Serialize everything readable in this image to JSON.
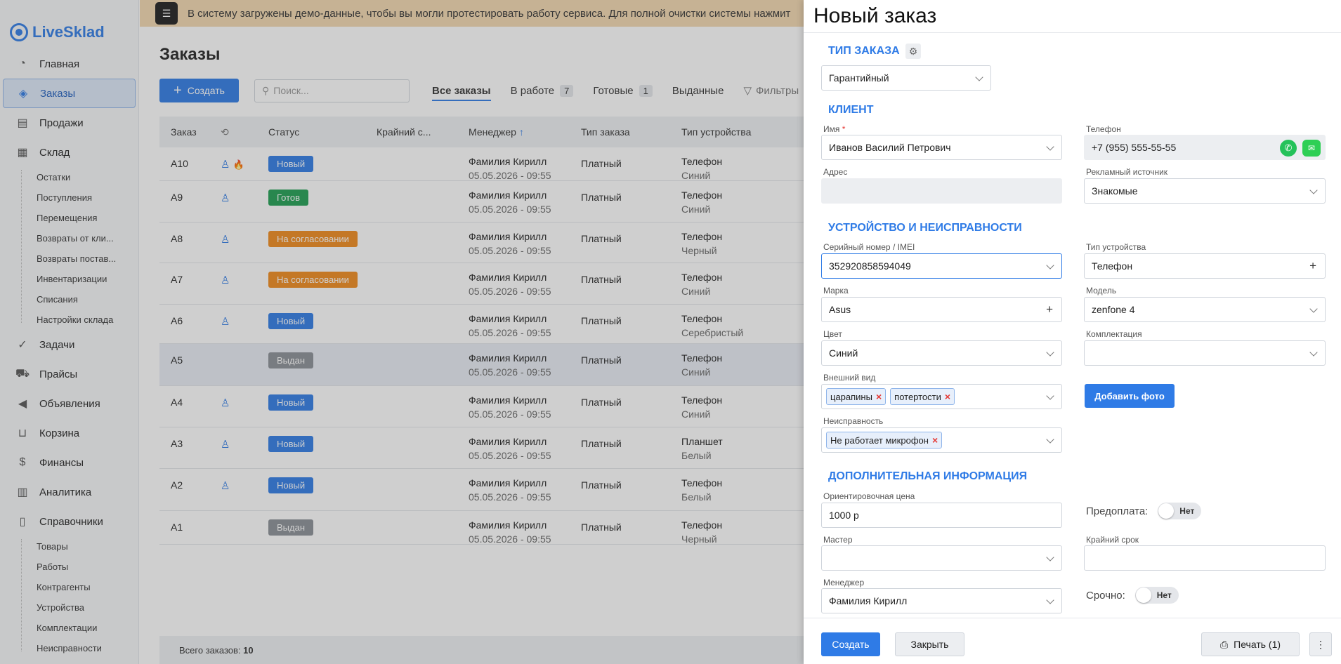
{
  "app": {
    "logo": "LiveSklad"
  },
  "sidebar": {
    "items": [
      {
        "label": "Главная",
        "icon": "gauge-icon"
      },
      {
        "label": "Заказы",
        "icon": "layers-icon",
        "active": true
      },
      {
        "label": "Продажи",
        "icon": "cash-register-icon"
      },
      {
        "label": "Склад",
        "icon": "boxes-icon"
      }
    ],
    "warehouse_sub": [
      "Остатки",
      "Поступления",
      "Перемещения",
      "Возвраты от кли...",
      "Возвраты постав...",
      "Инвентаризации",
      "Списания",
      "Настройки склада"
    ],
    "items2": [
      {
        "label": "Задачи",
        "icon": "check-circle-icon"
      },
      {
        "label": "Прайсы",
        "icon": "truck-icon"
      },
      {
        "label": "Объявления",
        "icon": "megaphone-icon"
      },
      {
        "label": "Корзина",
        "icon": "basket-icon"
      },
      {
        "label": "Финансы",
        "icon": "money-bag-icon"
      },
      {
        "label": "Аналитика",
        "icon": "chart-icon"
      },
      {
        "label": "Справочники",
        "icon": "book-icon"
      }
    ],
    "reference_sub": [
      "Товары",
      "Работы",
      "Контрагенты",
      "Устройства",
      "Комплектации",
      "Неисправности"
    ]
  },
  "banner": {
    "text": "В систему загружены демо-данные, чтобы вы могли протестировать работу сервиса. Для полной очистки системы нажмит"
  },
  "orders": {
    "title": "Заказы",
    "create_label": "Создать",
    "search_placeholder": "Поиск...",
    "tabs": [
      {
        "label": "Все заказы",
        "count": ""
      },
      {
        "label": "В работе",
        "count": "7"
      },
      {
        "label": "Готовые",
        "count": "1"
      },
      {
        "label": "Выданные",
        "count": ""
      }
    ],
    "filter_label": "Фильтры",
    "columns": {
      "order": "Заказ",
      "status": "Статус",
      "deadline": "Крайний с...",
      "manager": "Менеджер",
      "order_type": "Тип заказа",
      "device_type": "Тип устройства"
    },
    "rows": [
      {
        "id": "A10",
        "status": "Новый",
        "status_kind": "new",
        "manager": "Фамилия Кирилл",
        "date": "05.05.2026 - 09:55",
        "type": "Платный",
        "device": "Телефон",
        "color": "Синий",
        "person": true,
        "fire": true
      },
      {
        "id": "A9",
        "status": "Готов",
        "status_kind": "ready",
        "manager": "Фамилия Кирилл",
        "date": "05.05.2026 - 09:55",
        "type": "Платный",
        "device": "Телефон",
        "color": "Синий",
        "person": true
      },
      {
        "id": "A8",
        "status": "На согласовании",
        "status_kind": "agree",
        "manager": "Фамилия Кирилл",
        "date": "05.05.2026 - 09:55",
        "type": "Платный",
        "device": "Телефон",
        "color": "Черный",
        "person": true
      },
      {
        "id": "A7",
        "status": "На согласовании",
        "status_kind": "agree",
        "manager": "Фамилия Кирилл",
        "date": "05.05.2026 - 09:55",
        "type": "Платный",
        "device": "Телефон",
        "color": "Синий",
        "person": true
      },
      {
        "id": "A6",
        "status": "Новый",
        "status_kind": "new",
        "manager": "Фамилия Кирилл",
        "date": "05.05.2026 - 09:55",
        "type": "Платный",
        "device": "Телефон",
        "color": "Серебристый",
        "person": true
      },
      {
        "id": "A5",
        "status": "Выдан",
        "status_kind": "issued",
        "manager": "Фамилия Кирилл",
        "date": "05.05.2026 - 09:55",
        "type": "Платный",
        "device": "Телефон",
        "color": "Синий",
        "person": false,
        "highlight": true
      },
      {
        "id": "A4",
        "status": "Новый",
        "status_kind": "new",
        "manager": "Фамилия Кирилл",
        "date": "05.05.2026 - 09:55",
        "type": "Платный",
        "device": "Телефон",
        "color": "Синий",
        "person": true
      },
      {
        "id": "A3",
        "status": "Новый",
        "status_kind": "new",
        "manager": "Фамилия Кирилл",
        "date": "05.05.2026 - 09:55",
        "type": "Платный",
        "device": "Планшет",
        "color": "Белый",
        "person": true
      },
      {
        "id": "A2",
        "status": "Новый",
        "status_kind": "new",
        "manager": "Фамилия Кирилл",
        "date": "05.05.2026 - 09:55",
        "type": "Платный",
        "device": "Телефон",
        "color": "Белый",
        "person": true
      },
      {
        "id": "A1",
        "status": "Выдан",
        "status_kind": "issued",
        "manager": "Фамилия Кирилл",
        "date": "05.05.2026 - 09:55",
        "type": "Платный",
        "device": "Телефон",
        "color": "Черный",
        "person": false
      }
    ],
    "total_label": "Всего заказов:",
    "total_value": "10"
  },
  "drawer": {
    "title": "Новый заказ",
    "order_type_section": "ТИП ЗАКАЗА",
    "order_type_value": "Гарантийный",
    "client_section": "КЛИЕНТ",
    "name_label": "Имя",
    "name_value": "Иванов Василий Петрович",
    "phone_label": "Телефон",
    "phone_value": "+7 (955) 555-55-55",
    "address_label": "Адрес",
    "ad_source_label": "Рекламный источник",
    "ad_source_value": "Знакомые",
    "device_section": "УСТРОЙСТВО И НЕИСПРАВНОСТИ",
    "serial_label": "Серийный номер / IMEI",
    "serial_value": "352920858594049",
    "device_type_label": "Тип устройства",
    "device_type_value": "Телефон",
    "brand_label": "Марка",
    "brand_value": "Asus",
    "model_label": "Модель",
    "model_value": "zenfone 4",
    "color_label": "Цвет",
    "color_value": "Синий",
    "kit_label": "Комплектация",
    "appearance_label": "Внешний вид",
    "appearance_tags": [
      "царапины",
      "потертости"
    ],
    "add_photo_label": "Добавить фото",
    "malfunction_label": "Неисправность",
    "malfunction_tags": [
      "Не работает микрофон"
    ],
    "extra_section": "ДОПОЛНИТЕЛЬНАЯ ИНФОРМАЦИЯ",
    "price_label": "Ориентировочная цена",
    "price_value": "1000 р",
    "prepay_label": "Предоплата:",
    "prepay_value": "Нет",
    "master_label": "Мастер",
    "deadline_label": "Крайний срок",
    "manager_label": "Менеджер",
    "manager_value": "Фамилия Кирилл",
    "urgent_label": "Срочно:",
    "urgent_value": "Нет",
    "create_btn": "Создать",
    "close_btn": "Закрыть",
    "print_btn": "Печать (1)"
  },
  "colors": {
    "accent": "#2f7be6",
    "status_new": "#2f7be6",
    "status_ready": "#1e9e52",
    "status_agree": "#f08a1c",
    "status_issued": "#8a8f96"
  }
}
